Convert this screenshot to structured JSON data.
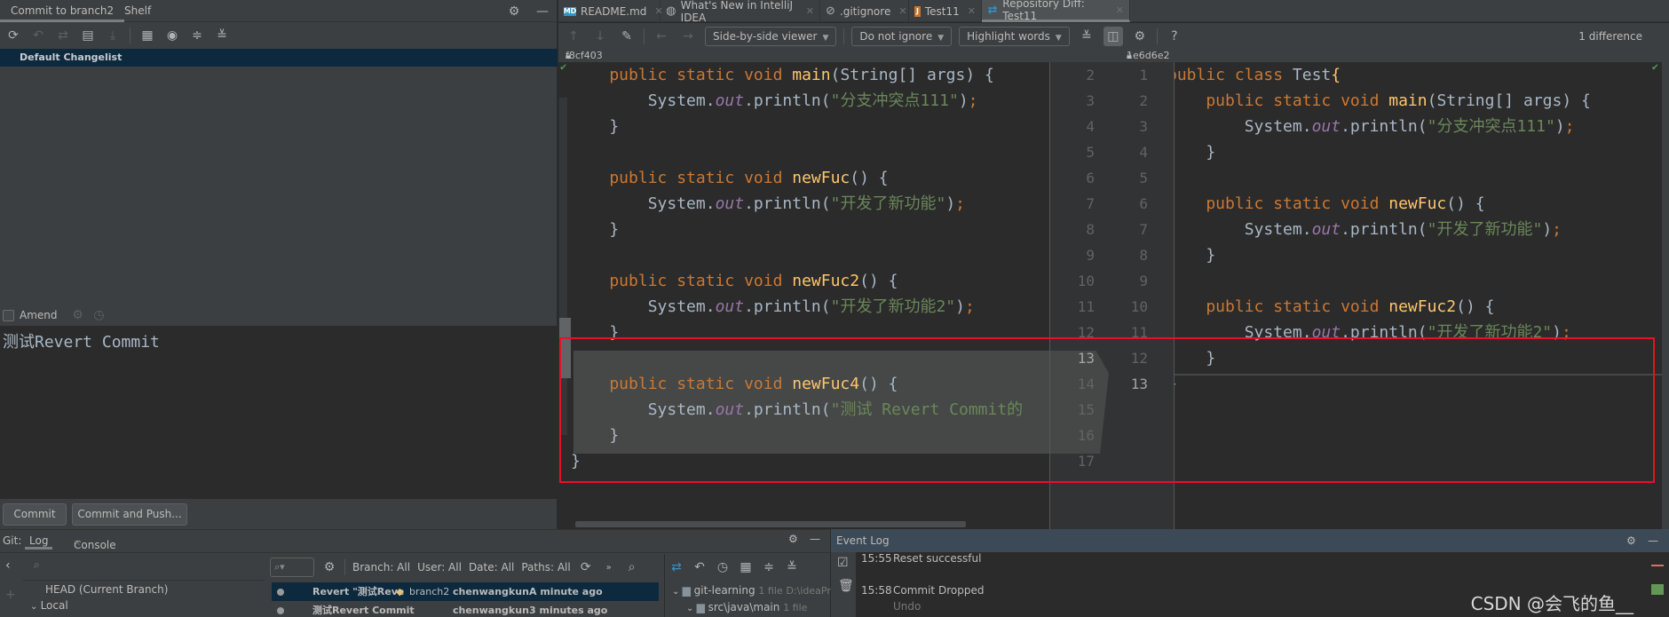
{
  "commit_panel": {
    "tabs": [
      {
        "label": "Commit to branch2",
        "active": true
      },
      {
        "label": "Shelf",
        "active": false
      }
    ],
    "toolbar_icons": [
      "refresh-icon",
      "rollback-icon",
      "show-diff-icon",
      "changelist-icon",
      "update-icon",
      "group-by-icon",
      "view-options-icon",
      "expand-all-icon",
      "collapse-all-icon"
    ],
    "changelist": "Default Changelist",
    "amend_label": "Amend",
    "amend_checked": false,
    "commit_message": "测试Revert Commit",
    "commit_button": "Commit",
    "commit_push_button": "Commit and Push..."
  },
  "editor_tabs": [
    {
      "label": "README.md",
      "icon": "markdown-file-icon",
      "active": false
    },
    {
      "label": "What's New in IntelliJ IDEA",
      "icon": "globe-icon",
      "active": false
    },
    {
      "label": ".gitignore",
      "icon": "gitignore-file-icon",
      "active": false
    },
    {
      "label": "Test11",
      "icon": "java-file-icon",
      "active": false
    },
    {
      "label": "Repository Diff: Test11",
      "icon": "diff-icon",
      "active": true
    }
  ],
  "diff_toolbar": {
    "viewer": "Side-by-side viewer",
    "ignore": "Do not ignore",
    "highlight": "Highlight words",
    "difference_count": "1 difference",
    "help": "?"
  },
  "revisions": {
    "left": "f8cf403",
    "right": "1e6d6e2 (Test11)"
  },
  "left_code": {
    "line_numbers": [
      "2",
      "3",
      "4",
      "5",
      "6",
      "7",
      "8",
      "9",
      "10",
      "11",
      "12",
      "13",
      "14",
      "15",
      "16",
      "17"
    ],
    "lines": [
      [
        [
          "kw",
          "    public static void "
        ],
        [
          "fn",
          "main"
        ],
        [
          "plain",
          "(String[] args) {"
        ]
      ],
      [
        [
          "plain",
          "        System."
        ],
        [
          "field",
          "out"
        ],
        [
          "plain",
          ".println("
        ],
        [
          "str",
          "\"分支冲突点111\""
        ],
        [
          "plain",
          ")"
        ],
        [
          "semi",
          ";"
        ]
      ],
      [
        [
          "plain",
          "    }"
        ]
      ],
      [],
      [
        [
          "kw",
          "    public static void "
        ],
        [
          "fn",
          "newFuc"
        ],
        [
          "plain",
          "() {"
        ]
      ],
      [
        [
          "plain",
          "        System."
        ],
        [
          "field",
          "out"
        ],
        [
          "plain",
          ".println("
        ],
        [
          "str",
          "\"开发了新功能\""
        ],
        [
          "plain",
          ")"
        ],
        [
          "semi",
          ";"
        ]
      ],
      [
        [
          "plain",
          "    }"
        ]
      ],
      [],
      [
        [
          "kw",
          "    public static void "
        ],
        [
          "fn",
          "newFuc2"
        ],
        [
          "plain",
          "() {"
        ]
      ],
      [
        [
          "plain",
          "        System."
        ],
        [
          "field",
          "out"
        ],
        [
          "plain",
          ".println("
        ],
        [
          "str",
          "\"开发了新功能2\""
        ],
        [
          "plain",
          ")"
        ],
        [
          "semi",
          ";"
        ]
      ],
      [
        [
          "plain",
          "    }"
        ]
      ],
      [],
      [
        [
          "kw",
          "    public static void "
        ],
        [
          "fn",
          "newFuc4"
        ],
        [
          "plain",
          "() {"
        ]
      ],
      [
        [
          "plain",
          "        System."
        ],
        [
          "field",
          "out"
        ],
        [
          "plain",
          ".println("
        ],
        [
          "str",
          "\"测试 Revert Commit的"
        ]
      ],
      [
        [
          "plain",
          "    }"
        ]
      ],
      [
        [
          "plain",
          "}"
        ]
      ]
    ]
  },
  "right_code": {
    "line_numbers": [
      "1",
      "2",
      "3",
      "4",
      "5",
      "6",
      "7",
      "8",
      "9",
      "10",
      "11",
      "12",
      "13"
    ],
    "lines": [
      [
        [
          "kw",
          "public class "
        ],
        [
          "plain",
          "Test"
        ],
        [
          "fn",
          "{"
        ]
      ],
      [
        [
          "kw",
          "    public static void "
        ],
        [
          "fn",
          "main"
        ],
        [
          "plain",
          "(String[] args) {"
        ]
      ],
      [
        [
          "plain",
          "        System."
        ],
        [
          "field",
          "out"
        ],
        [
          "plain",
          ".println("
        ],
        [
          "str",
          "\"分支冲突点111\""
        ],
        [
          "plain",
          ")"
        ],
        [
          "semi",
          ";"
        ]
      ],
      [
        [
          "plain",
          "    }"
        ]
      ],
      [],
      [
        [
          "kw",
          "    public static void "
        ],
        [
          "fn",
          "newFuc"
        ],
        [
          "plain",
          "() {"
        ]
      ],
      [
        [
          "plain",
          "        System."
        ],
        [
          "field",
          "out"
        ],
        [
          "plain",
          ".println("
        ],
        [
          "str",
          "\"开发了新功能\""
        ],
        [
          "plain",
          ")"
        ],
        [
          "semi",
          ";"
        ]
      ],
      [
        [
          "plain",
          "    }"
        ]
      ],
      [],
      [
        [
          "kw",
          "    public static void "
        ],
        [
          "fn",
          "newFuc2"
        ],
        [
          "plain",
          "() {"
        ]
      ],
      [
        [
          "plain",
          "        System."
        ],
        [
          "field",
          "out"
        ],
        [
          "plain",
          ".println("
        ],
        [
          "str",
          "\"开发了新功能2\""
        ],
        [
          "plain",
          ")"
        ],
        [
          "semi",
          ";"
        ]
      ],
      [
        [
          "plain",
          "    }"
        ]
      ],
      [
        [
          "fn",
          "}"
        ]
      ]
    ]
  },
  "git_window": {
    "title": "Git:",
    "tabs": [
      {
        "label": "Log",
        "active": true
      },
      {
        "label": "Console",
        "active": false
      }
    ],
    "branches": [
      {
        "label": "HEAD (Current Branch)",
        "expanded": null
      },
      {
        "label": "Local",
        "expanded": true
      }
    ],
    "filters": [
      "Branch: All",
      "User: All",
      "Date: All",
      "Paths: All"
    ],
    "commits": [
      {
        "message": "Revert \"测试Reve",
        "branch": "branch2",
        "author": "chenwangkun",
        "time": "A minute ago",
        "selected": true
      },
      {
        "message": "测试Revert Commit",
        "branch": "",
        "author": "chenwangkun",
        "time": "3 minutes ago",
        "selected": false
      }
    ],
    "changes_tree": [
      {
        "name": "git-learning",
        "info": "1 file",
        "path": "D:\\ideaPr"
      },
      {
        "name": "src\\java\\main",
        "info": "1 file",
        "path": ""
      }
    ]
  },
  "event_log": {
    "title": "Event Log",
    "events": [
      {
        "time": "15:55",
        "text": "Reset successful",
        "link": ""
      },
      {
        "time": "15:58",
        "text": "Commit Dropped",
        "link": "Undo"
      }
    ]
  },
  "watermark": "CSDN @会飞的鱼__"
}
